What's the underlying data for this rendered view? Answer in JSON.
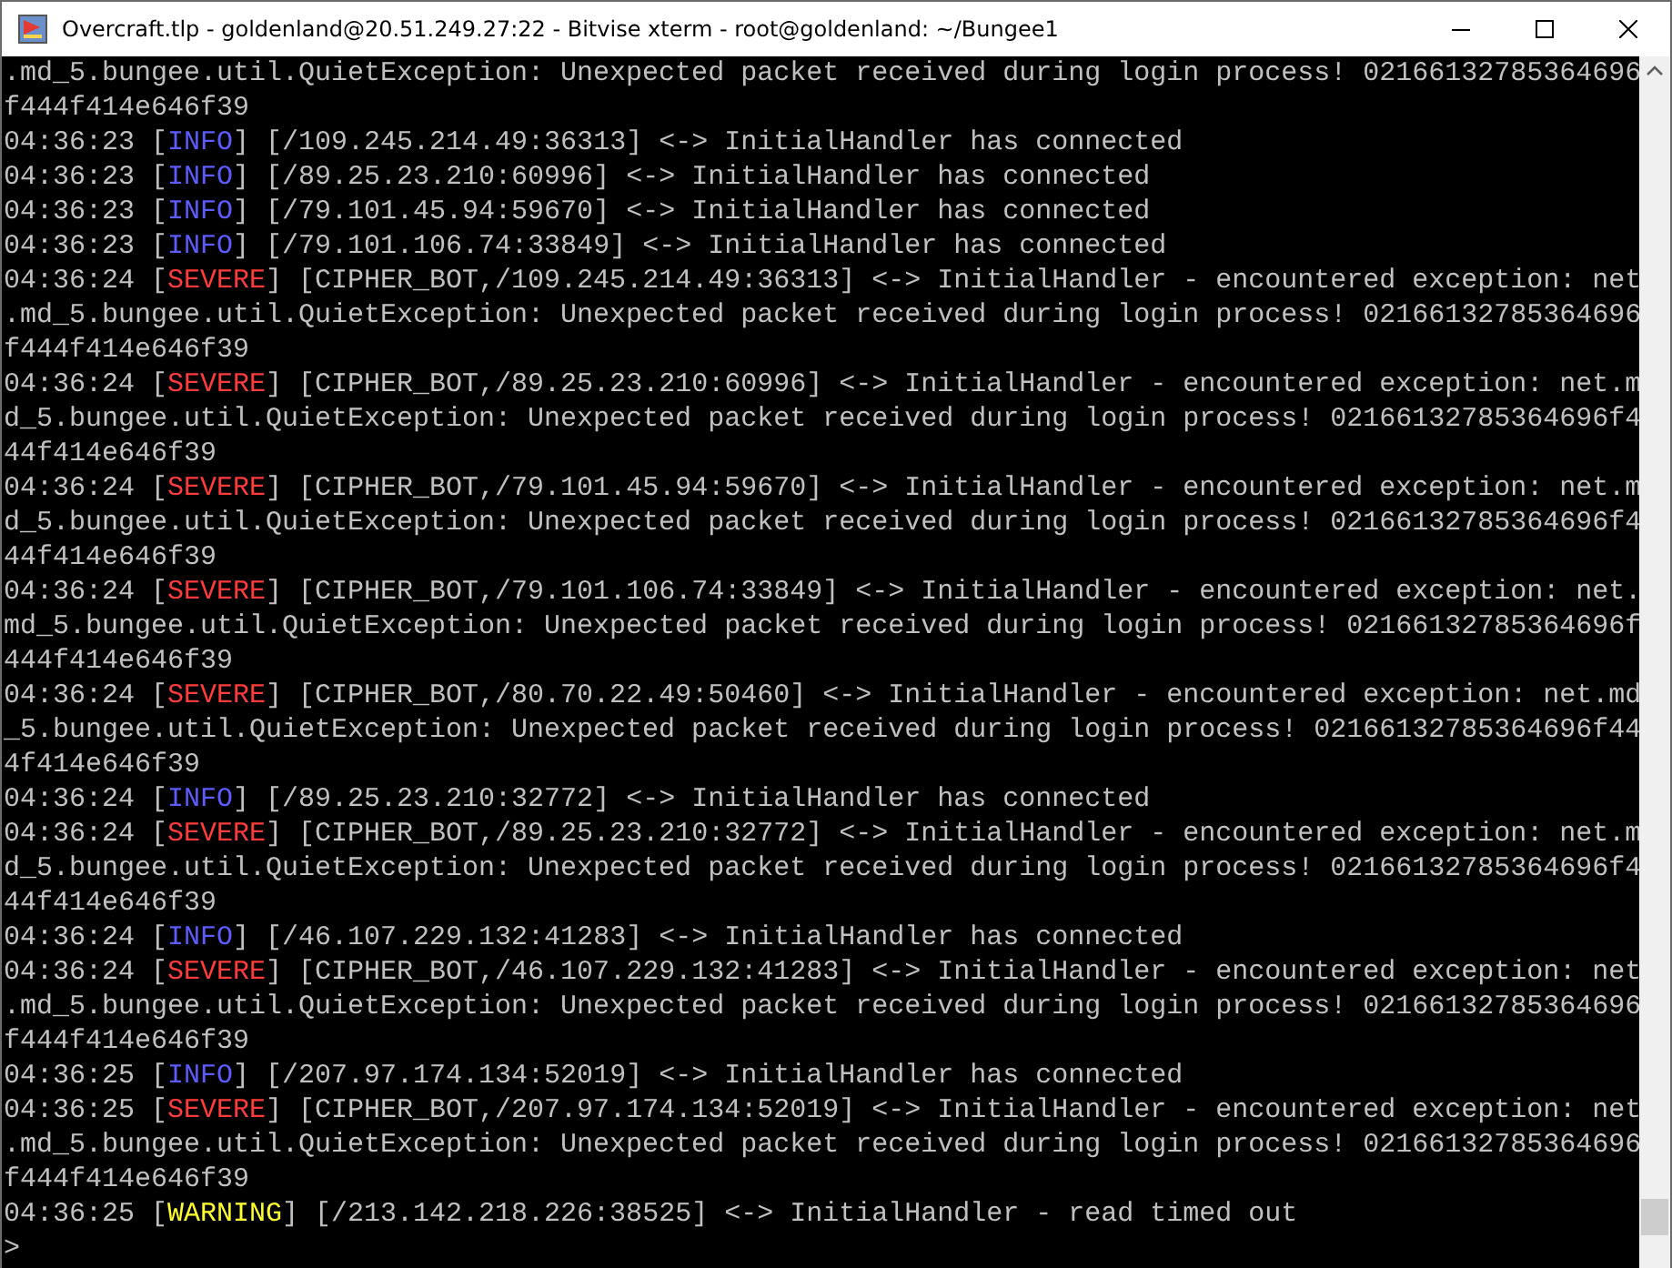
{
  "window": {
    "title": "Overcraft.tlp - goldenland@20.51.249.27:22 - Bitvise xterm - root@goldenland: ~/Bungee1"
  },
  "terminal": {
    "lines": [
      [
        {
          "text": ".md_5.bungee.util.QuietException: Unexpected packet received during login process! 02166132785364696"
        }
      ],
      [
        {
          "text": "f444f414e646f39"
        }
      ],
      [
        {
          "text": "04:36:23 ["
        },
        {
          "text": "INFO",
          "color": "#5c5cff"
        },
        {
          "text": "] [/109.245.214.49:36313] <-> InitialHandler has connected"
        }
      ],
      [
        {
          "text": "04:36:23 ["
        },
        {
          "text": "INFO",
          "color": "#5c5cff"
        },
        {
          "text": "] [/89.25.23.210:60996] <-> InitialHandler has connected"
        }
      ],
      [
        {
          "text": "04:36:23 ["
        },
        {
          "text": "INFO",
          "color": "#5c5cff"
        },
        {
          "text": "] [/79.101.45.94:59670] <-> InitialHandler has connected"
        }
      ],
      [
        {
          "text": "04:36:23 ["
        },
        {
          "text": "INFO",
          "color": "#5c5cff"
        },
        {
          "text": "] [/79.101.106.74:33849] <-> InitialHandler has connected"
        }
      ],
      [
        {
          "text": "04:36:24 ["
        },
        {
          "text": "SEVERE",
          "color": "#ff3b3b"
        },
        {
          "text": "] [CIPHER_BOT,/109.245.214.49:36313] <-> InitialHandler - encountered exception: net"
        }
      ],
      [
        {
          "text": ".md_5.bungee.util.QuietException: Unexpected packet received during login process! 02166132785364696"
        }
      ],
      [
        {
          "text": "f444f414e646f39"
        }
      ],
      [
        {
          "text": "04:36:24 ["
        },
        {
          "text": "SEVERE",
          "color": "#ff3b3b"
        },
        {
          "text": "] [CIPHER_BOT,/89.25.23.210:60996] <-> InitialHandler - encountered exception: net.m"
        }
      ],
      [
        {
          "text": "d_5.bungee.util.QuietException: Unexpected packet received during login process! 02166132785364696f4"
        }
      ],
      [
        {
          "text": "44f414e646f39"
        }
      ],
      [
        {
          "text": "04:36:24 ["
        },
        {
          "text": "SEVERE",
          "color": "#ff3b3b"
        },
        {
          "text": "] [CIPHER_BOT,/79.101.45.94:59670] <-> InitialHandler - encountered exception: net.m"
        }
      ],
      [
        {
          "text": "d_5.bungee.util.QuietException: Unexpected packet received during login process! 02166132785364696f4"
        }
      ],
      [
        {
          "text": "44f414e646f39"
        }
      ],
      [
        {
          "text": "04:36:24 ["
        },
        {
          "text": "SEVERE",
          "color": "#ff3b3b"
        },
        {
          "text": "] [CIPHER_BOT,/79.101.106.74:33849] <-> InitialHandler - encountered exception: net."
        }
      ],
      [
        {
          "text": "md_5.bungee.util.QuietException: Unexpected packet received during login process! 02166132785364696f"
        }
      ],
      [
        {
          "text": "444f414e646f39"
        }
      ],
      [
        {
          "text": "04:36:24 ["
        },
        {
          "text": "SEVERE",
          "color": "#ff3b3b"
        },
        {
          "text": "] [CIPHER_BOT,/80.70.22.49:50460] <-> InitialHandler - encountered exception: net.md"
        }
      ],
      [
        {
          "text": "_5.bungee.util.QuietException: Unexpected packet received during login process! 02166132785364696f44"
        }
      ],
      [
        {
          "text": "4f414e646f39"
        }
      ],
      [
        {
          "text": "04:36:24 ["
        },
        {
          "text": "INFO",
          "color": "#5c5cff"
        },
        {
          "text": "] [/89.25.23.210:32772] <-> InitialHandler has connected"
        }
      ],
      [
        {
          "text": "04:36:24 ["
        },
        {
          "text": "SEVERE",
          "color": "#ff3b3b"
        },
        {
          "text": "] [CIPHER_BOT,/89.25.23.210:32772] <-> InitialHandler - encountered exception: net.m"
        }
      ],
      [
        {
          "text": "d_5.bungee.util.QuietException: Unexpected packet received during login process! 02166132785364696f4"
        }
      ],
      [
        {
          "text": "44f414e646f39"
        }
      ],
      [
        {
          "text": "04:36:24 ["
        },
        {
          "text": "INFO",
          "color": "#5c5cff"
        },
        {
          "text": "] [/46.107.229.132:41283] <-> InitialHandler has connected"
        }
      ],
      [
        {
          "text": "04:36:24 ["
        },
        {
          "text": "SEVERE",
          "color": "#ff3b3b"
        },
        {
          "text": "] [CIPHER_BOT,/46.107.229.132:41283] <-> InitialHandler - encountered exception: net"
        }
      ],
      [
        {
          "text": ".md_5.bungee.util.QuietException: Unexpected packet received during login process! 02166132785364696"
        }
      ],
      [
        {
          "text": "f444f414e646f39"
        }
      ],
      [
        {
          "text": "04:36:25 ["
        },
        {
          "text": "INFO",
          "color": "#5c5cff"
        },
        {
          "text": "] [/207.97.174.134:52019] <-> InitialHandler has connected"
        }
      ],
      [
        {
          "text": "04:36:25 ["
        },
        {
          "text": "SEVERE",
          "color": "#ff3b3b"
        },
        {
          "text": "] [CIPHER_BOT,/207.97.174.134:52019] <-> InitialHandler - encountered exception: net"
        }
      ],
      [
        {
          "text": ".md_5.bungee.util.QuietException: Unexpected packet received during login process! 02166132785364696"
        }
      ],
      [
        {
          "text": "f444f414e646f39"
        }
      ],
      [
        {
          "text": "04:36:25 ["
        },
        {
          "text": "WARNING",
          "color": "#ffff2e"
        },
        {
          "text": "] [/213.142.218.226:38525] <-> InitialHandler - read timed out"
        }
      ],
      [
        {
          "text": ">"
        }
      ]
    ]
  }
}
